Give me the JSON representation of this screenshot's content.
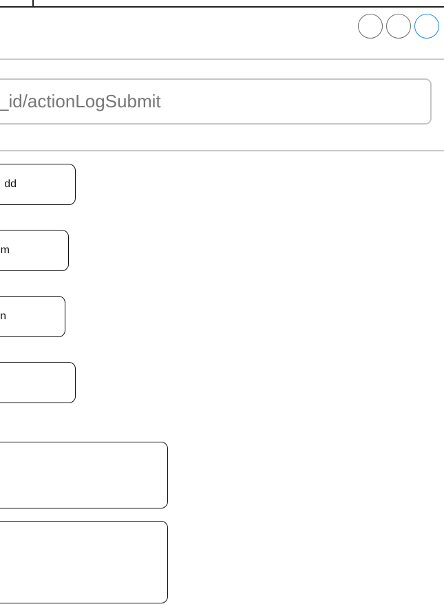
{
  "window": {
    "controls": [
      {
        "name": "left-circle",
        "color": "#6a6a6a"
      },
      {
        "name": "middle-circle",
        "color": "#6a6a6a"
      },
      {
        "name": "right-circle",
        "color": "#1a8cf0"
      }
    ]
  },
  "address_bar": {
    "value": "_id/actionLogSubmit"
  },
  "buttons": [
    {
      "label": "dd"
    },
    {
      "label": "m"
    },
    {
      "label": "n"
    },
    {
      "label": ""
    },
    {
      "label": ""
    },
    {
      "label": ""
    }
  ],
  "colors": {
    "accent": "#1a8cf0",
    "border": "#111111",
    "divider": "#c9c9c9",
    "field_text": "#777777"
  }
}
